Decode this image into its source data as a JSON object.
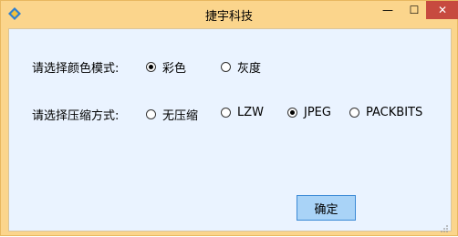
{
  "window": {
    "title": "捷宇科技",
    "minimize_glyph": "—",
    "maximize_glyph": "☐",
    "close_glyph": "✕"
  },
  "color_mode": {
    "label": "请选择颜色模式:",
    "options": [
      {
        "label": "彩色",
        "selected": true
      },
      {
        "label": "灰度",
        "selected": false
      }
    ]
  },
  "compression": {
    "label": "请选择压缩方式:",
    "options": [
      {
        "label": "无压缩",
        "selected": false
      },
      {
        "label": "LZW",
        "selected": false
      },
      {
        "label": "JPEG",
        "selected": true
      },
      {
        "label": "PACKBITS",
        "selected": false
      }
    ]
  },
  "ok_button": {
    "label": "确定"
  },
  "colors": {
    "frame": "#fbd58c",
    "client": "#eaf3ff",
    "close": "#c74a3f",
    "button": "#a9d3f7"
  }
}
